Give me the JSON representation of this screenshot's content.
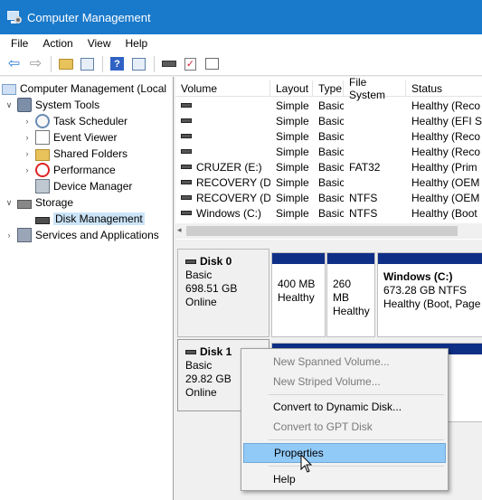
{
  "window": {
    "title": "Computer Management",
    "icon": "computer-management-icon"
  },
  "menu": [
    "File",
    "Action",
    "View",
    "Help"
  ],
  "toolbar": [
    "back-arrow-icon",
    "forward-arrow-icon",
    "up-folder-icon",
    "show-hide-tree-icon",
    "help-icon",
    "properties-icon",
    "disk-icon",
    "check-icon",
    "list-icon"
  ],
  "tree": {
    "root": "Computer Management (Local",
    "system_tools": "System Tools",
    "task_scheduler": "Task Scheduler",
    "event_viewer": "Event Viewer",
    "shared_folders": "Shared Folders",
    "performance": "Performance",
    "device_manager": "Device Manager",
    "storage": "Storage",
    "disk_management": "Disk Management",
    "services": "Services and Applications"
  },
  "volumes": {
    "headers": [
      "Volume",
      "Layout",
      "Type",
      "File System",
      "Status"
    ],
    "rows": [
      [
        "",
        "Simple",
        "Basic",
        "",
        "Healthy (Reco"
      ],
      [
        "",
        "Simple",
        "Basic",
        "",
        "Healthy (EFI S"
      ],
      [
        "",
        "Simple",
        "Basic",
        "",
        "Healthy (Reco"
      ],
      [
        "",
        "Simple",
        "Basic",
        "",
        "Healthy (Reco"
      ],
      [
        "CRUZER (E:)",
        "Simple",
        "Basic",
        "FAT32",
        "Healthy (Prim"
      ],
      [
        "RECOVERY (D:)",
        "Simple",
        "Basic",
        "",
        "Healthy (OEM"
      ],
      [
        "RECOVERY (D:)",
        "Simple",
        "Basic",
        "NTFS",
        "Healthy (OEM"
      ],
      [
        "Windows (C:)",
        "Simple",
        "Basic",
        "NTFS",
        "Healthy (Boot"
      ]
    ]
  },
  "disks": [
    {
      "name": "Disk 0",
      "type": "Basic",
      "size": "698.51 GB",
      "status": "Online"
    },
    {
      "name": "Disk 1",
      "type": "Basic",
      "size": "29.82 GB",
      "status": "Online"
    }
  ],
  "partitions": {
    "p1": {
      "size": "400 MB",
      "status": "Healthy"
    },
    "p2": {
      "size": "260 MB",
      "status": "Healthy"
    },
    "p3": {
      "name": "Windows  (C:)",
      "size": "673.28 GB NTFS",
      "status": "Healthy (Boot, Page"
    }
  },
  "context_menu": {
    "new_spanned": "New Spanned Volume...",
    "new_striped": "New Striped Volume...",
    "convert_dynamic": "Convert to Dynamic Disk...",
    "convert_gpt": "Convert to GPT Disk",
    "properties": "Properties",
    "help": "Help"
  },
  "colors": {
    "titlebar": "#1979ca",
    "partition_bar": "#0f2f86",
    "menu_hover": "#91c9f7",
    "tree_selected": "#cce4f7"
  }
}
